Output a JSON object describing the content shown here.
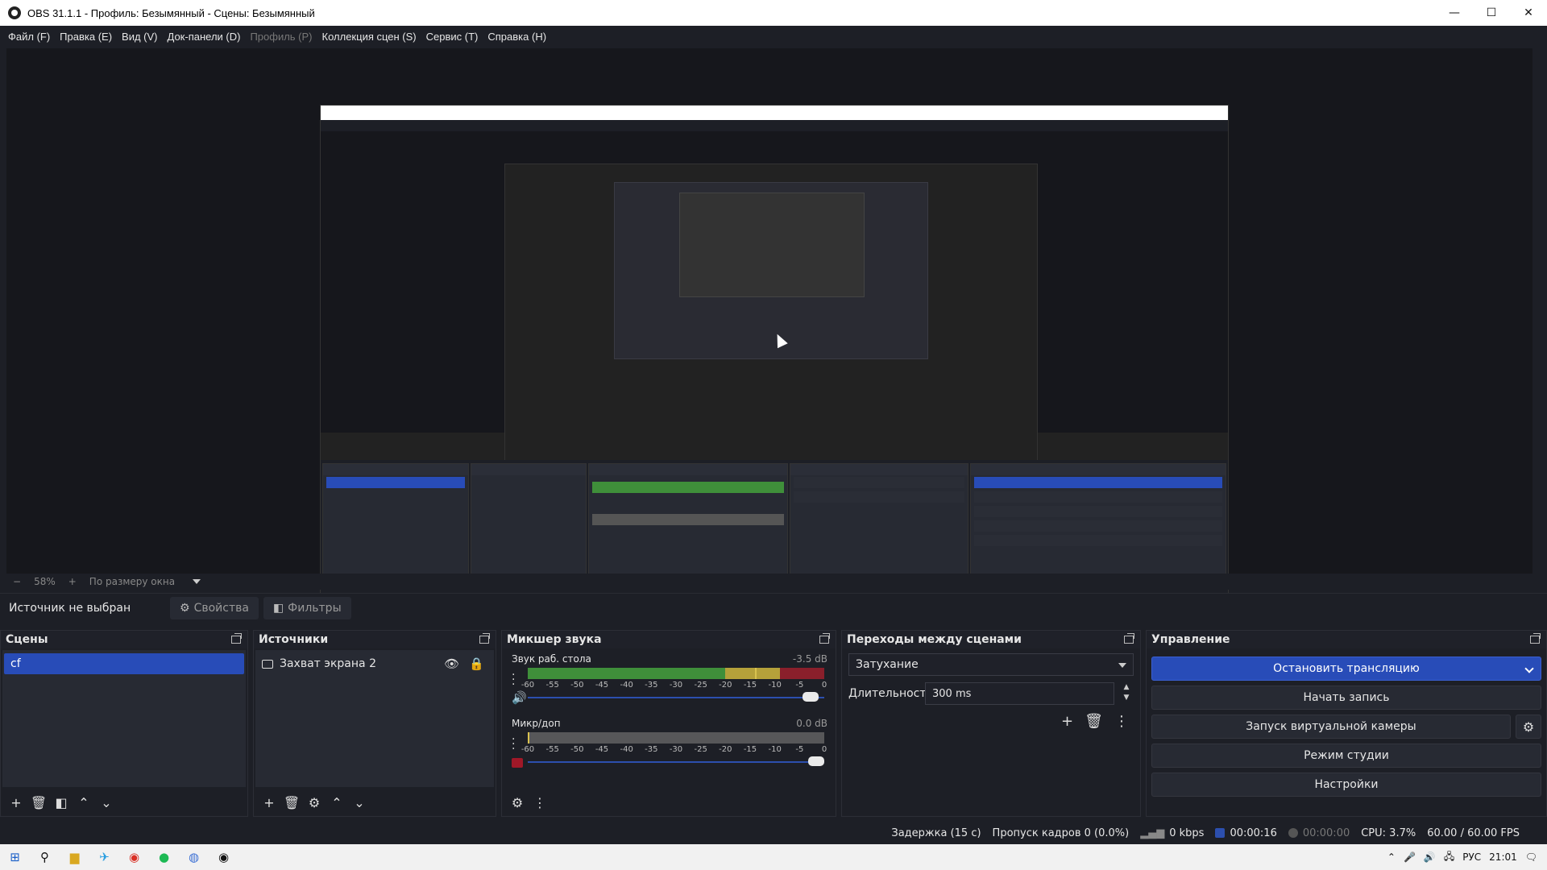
{
  "window": {
    "title": "OBS 31.1.1 - Профиль: Безымянный - Сцены: Безымянный",
    "minimize": "—",
    "maximize": "☐",
    "close": "✕"
  },
  "menu": [
    {
      "label": "Файл (F)",
      "disabled": false
    },
    {
      "label": "Правка (E)",
      "disabled": false
    },
    {
      "label": "Вид (V)",
      "disabled": false
    },
    {
      "label": "Док-панели (D)",
      "disabled": false
    },
    {
      "label": "Профиль (P)",
      "disabled": true
    },
    {
      "label": "Коллекция сцен (S)",
      "disabled": false
    },
    {
      "label": "Сервис (T)",
      "disabled": false
    },
    {
      "label": "Справка (H)",
      "disabled": false
    }
  ],
  "zoom": {
    "minus": "−",
    "value": "58%",
    "plus": "+",
    "fit_label": "По размеру окна"
  },
  "sourcebar": {
    "label": "Источник не выбран",
    "properties": "Свойства",
    "filters": "Фильтры"
  },
  "scenes": {
    "title": "Сцены",
    "items": [
      "cf"
    ]
  },
  "sources": {
    "title": "Источники",
    "items": [
      "Захват экрана 2"
    ]
  },
  "mixer": {
    "title": "Микшер звука",
    "scale": [
      "-60",
      "-55",
      "-50",
      "-45",
      "-40",
      "-35",
      "-30",
      "-25",
      "-20",
      "-15",
      "-10",
      "-5",
      "0"
    ],
    "tracks": [
      {
        "name": "Звук раб. стола",
        "db": "-3.5 dB",
        "level_db": -3.5,
        "volume": 0.98,
        "muted": false
      },
      {
        "name": "Микр/доп",
        "db": "0.0 dB",
        "level_db": 0,
        "volume": 1.0,
        "muted": true
      }
    ]
  },
  "transitions": {
    "title": "Переходы между сценами",
    "selected": "Затухание",
    "duration_label": "Длительность",
    "duration_value": "300 ms"
  },
  "controls": {
    "title": "Управление",
    "stop_stream": "Остановить трансляцию",
    "start_recording": "Начать запись",
    "virtual_camera": "Запуск виртуальной камеры",
    "studio_mode": "Режим студии",
    "settings": "Настройки"
  },
  "status": {
    "delay": "Задержка (15 с)",
    "dropped": "Пропуск кадров 0 (0.0%)",
    "kbps": "0 kbps",
    "stream_time": "00:00:16",
    "record_time": "00:00:00",
    "cpu": "CPU: 3.7%",
    "fps": "60.00 / 60.00 FPS"
  },
  "taskbar": {
    "lang": "РУС",
    "time": "21:01"
  },
  "colors": {
    "accent": "#284cb8",
    "meter_green": "#3f8f3a",
    "meter_yellow": "#b5a13a",
    "meter_red": "#8a1f2b"
  }
}
